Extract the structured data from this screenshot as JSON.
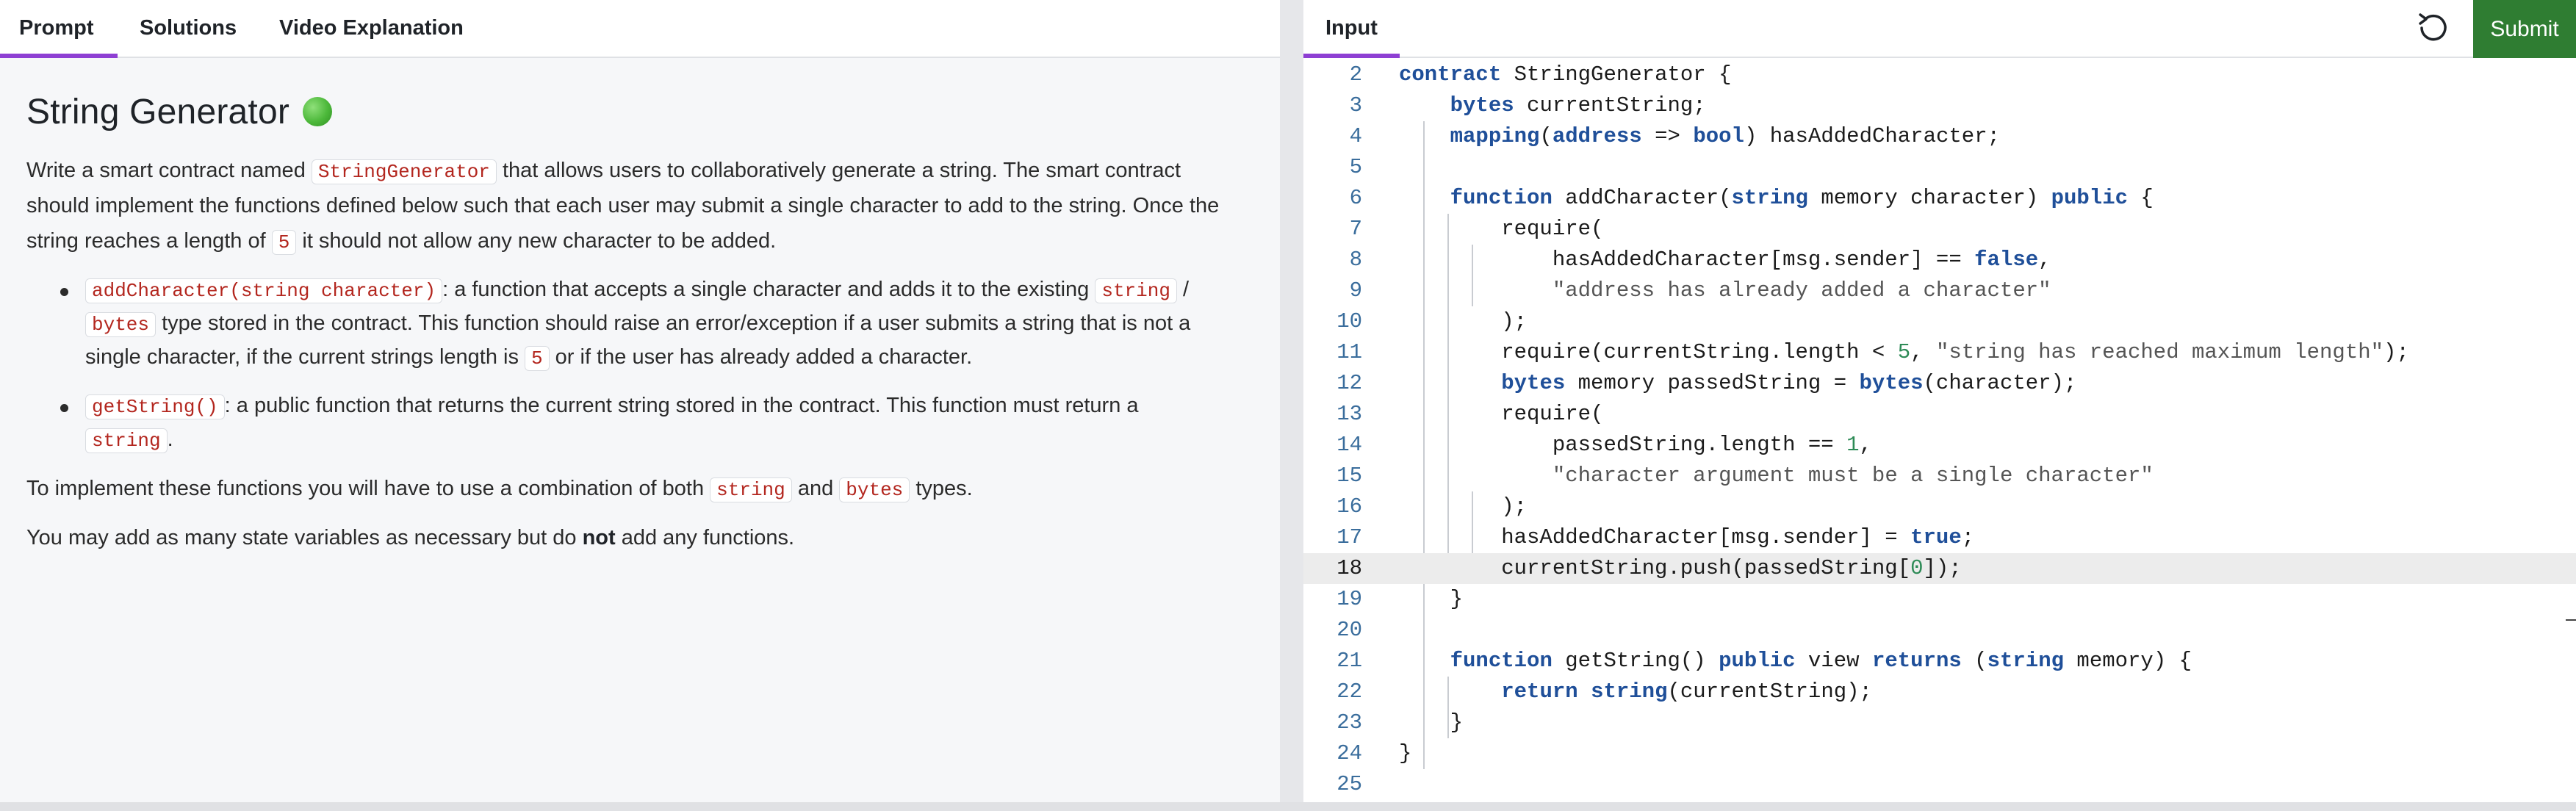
{
  "left_tabs": {
    "prompt": "Prompt",
    "solutions": "Solutions",
    "video": "Video Explanation"
  },
  "problem": {
    "title": "String Generator",
    "p1": {
      "a": "Write a smart contract named ",
      "code1": "StringGenerator",
      "b": " that allows users to collaboratively generate a string. The smart contract",
      "c": "should implement the functions defined below such that each user may submit a single character to add to the string. Once the",
      "d": "string reaches a length of ",
      "code2": "5",
      "e": " it should not allow any new character to be added."
    },
    "bullet1": {
      "code1": "addCharacter(string character)",
      "a": ": a function that accepts a single character and adds it to the existing ",
      "code2": "string",
      "b": " /",
      "code3": "bytes",
      "c": " type stored in the contract. This function should raise an error/exception if a user submits a string that is not a",
      "d": "single character, if the current strings length is ",
      "code4": "5",
      "e": " or if the user has already added a character."
    },
    "bullet2": {
      "code1": "getString()",
      "a": ": a public function that returns the current string stored in the contract. This function must return a",
      "code2": "string",
      "b": "."
    },
    "p2": {
      "a": "To implement these functions you will have to use a combination of both ",
      "code1": "string",
      "b": " and ",
      "code2": "bytes",
      "c": " types."
    },
    "p3": {
      "a": "You may add as many state variables as necessary but do ",
      "bold": "not",
      "b": " add any functions."
    }
  },
  "right_header": {
    "input_tab": "Input",
    "reset_icon": "reset-icon",
    "submit": "Submit"
  },
  "editor": {
    "current_line": "18",
    "line_numbers": [
      "2",
      "3",
      "4",
      "5",
      "6",
      "7",
      "8",
      "9",
      "10",
      "11",
      "12",
      "13",
      "14",
      "15",
      "16",
      "17",
      "18",
      "19",
      "20",
      "21",
      "22",
      "23",
      "24",
      "25"
    ]
  },
  "colors": {
    "accent": "#8e3fd3",
    "submit": "#2f7d32",
    "keyword": "#1f4f99",
    "inline_code": "#b3261e"
  }
}
